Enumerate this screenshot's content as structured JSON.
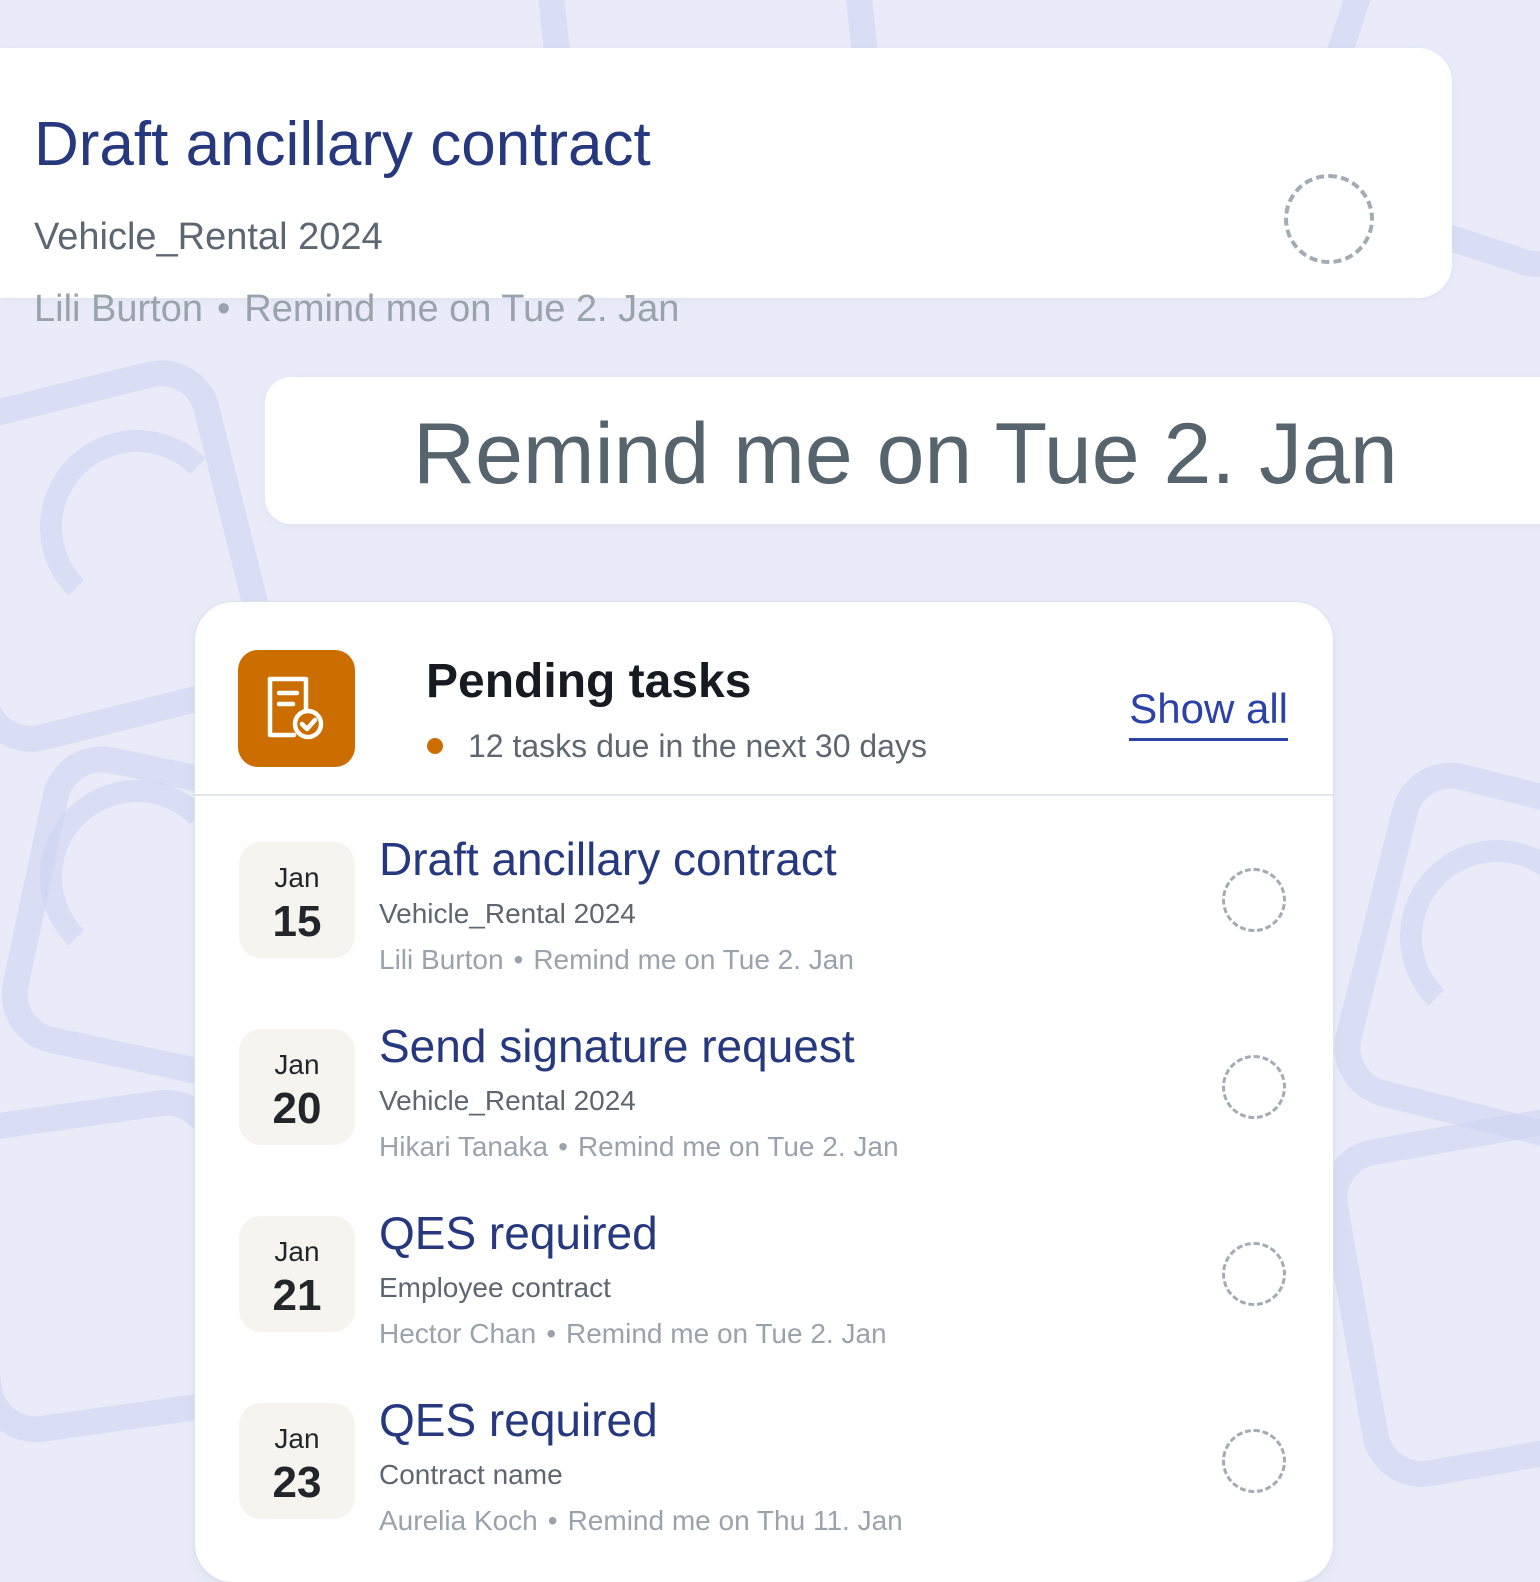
{
  "colors": {
    "background": "#e9ecf8",
    "title_blue": "#26397f",
    "accent_orange": "#cc6d00",
    "link_blue": "#2c42a7"
  },
  "zoom_card": {
    "title": "Draft ancillary contract",
    "subtitle": "Vehicle_Rental 2024",
    "assignee": "Lili Burton",
    "separator": "•",
    "reminder": "Remind me on Tue 2. Jan"
  },
  "reminder_banner": {
    "text": "Remind me on Tue 2. Jan"
  },
  "widget": {
    "icon": "document-check-icon",
    "title": "Pending tasks",
    "subtitle": "12 tasks due in the next 30 days",
    "show_all_label": "Show all",
    "tasks": [
      {
        "month": "Jan",
        "day": "15",
        "title": "Draft ancillary contract",
        "subtitle": "Vehicle_Rental 2024",
        "assignee": "Lili Burton",
        "separator": "•",
        "reminder": "Remind me on Tue 2. Jan"
      },
      {
        "month": "Jan",
        "day": "20",
        "title": "Send signature request",
        "subtitle": "Vehicle_Rental 2024",
        "assignee": "Hikari Tanaka",
        "separator": "•",
        "reminder": "Remind me on Tue 2. Jan"
      },
      {
        "month": "Jan",
        "day": "21",
        "title": "QES required",
        "subtitle": "Employee contract",
        "assignee": "Hector Chan",
        "separator": "•",
        "reminder": "Remind me on Tue 2. Jan"
      },
      {
        "month": "Jan",
        "day": "23",
        "title": "QES required",
        "subtitle": "Contract name",
        "assignee": "Aurelia Koch",
        "separator": "•",
        "reminder": "Remind me on Thu 11. Jan"
      }
    ]
  }
}
